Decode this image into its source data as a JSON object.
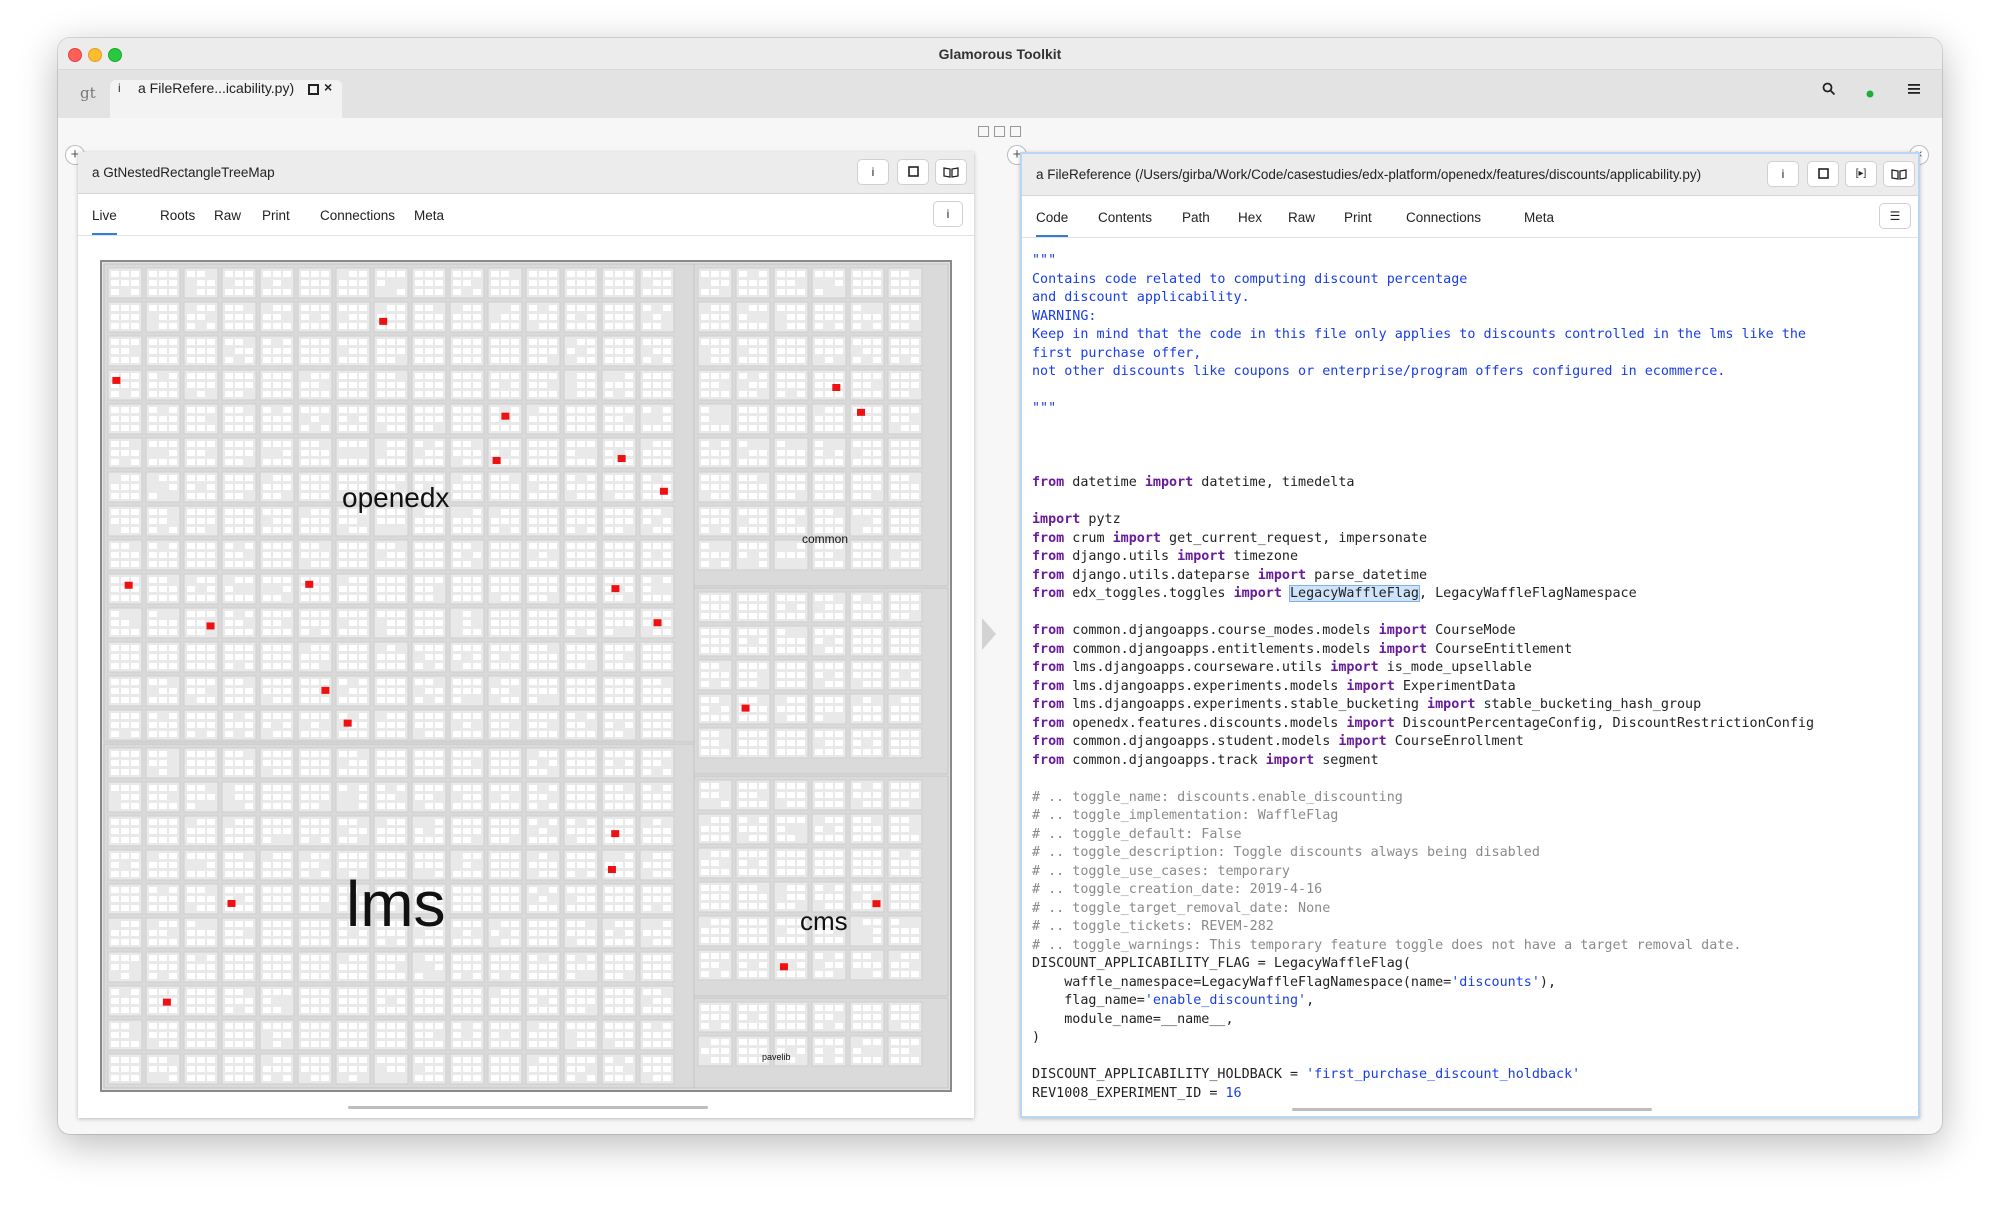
{
  "window": {
    "title": "Glamorous Toolkit",
    "logo": "gt",
    "tab": {
      "info_glyph": "i",
      "label": "a FileRefere...icability.py)",
      "close_glyph": "×"
    },
    "tools": {
      "search_glyph": "⌕",
      "status_glyph": "●",
      "menu_glyph": "≡"
    }
  },
  "left_pane": {
    "title": "a GtNestedRectangleTreeMap",
    "buttons": {
      "inspect": "i",
      "maximize": "□",
      "book": "📖"
    },
    "tabs": [
      "Live",
      "Roots",
      "Raw",
      "Print",
      "Connections",
      "Meta"
    ],
    "active_tab": "Live",
    "tab_action": "i",
    "add_glyph": "+",
    "treemap": {
      "labels": {
        "openedx": "openedx",
        "common": "common",
        "lms": "lms",
        "cms": "cms",
        "pavelib": "pavelib"
      },
      "highlight_color": "#ee1111"
    }
  },
  "right_pane": {
    "title": "a FileReference (/Users/girba/Work/Code/casestudies/edx-platform/openedx/features/discounts/applicability.py)",
    "buttons": {
      "inspect": "i",
      "maximize": "□",
      "play": "[▸]",
      "book": "📖"
    },
    "tabs": [
      "Code",
      "Contents",
      "Path",
      "Hex",
      "Raw",
      "Print",
      "Connections",
      "Meta"
    ],
    "active_tab": "Code",
    "tab_action": "☰",
    "add_glyph": "+",
    "close_glyph": "×",
    "code": {
      "doc_open": "\"\"\"",
      "doc_lines": [
        "Contains code related to computing discount percentage",
        "and discount applicability.",
        "",
        "WARNING:",
        "Keep in mind that the code in this file only applies to discounts controlled in the lms like the",
        "first purchase offer,",
        "not other discounts like coupons or enterprise/program offers configured in ecommerce.",
        "",
        "\"\"\""
      ],
      "imports": [
        [
          "from",
          " datetime ",
          "import",
          " datetime, timedelta"
        ],
        [
          "import",
          " pytz",
          "",
          ""
        ],
        [
          "from",
          " crum ",
          "import",
          " get_current_request, impersonate"
        ],
        [
          "from",
          " django.utils ",
          "import",
          " timezone"
        ],
        [
          "from",
          " django.utils.dateparse ",
          "import",
          " parse_datetime"
        ],
        [
          "from",
          " common.djangoapps.course_modes.models ",
          "import",
          " CourseMode"
        ],
        [
          "from",
          " common.djangoapps.entitlements.models ",
          "import",
          " CourseEntitlement"
        ],
        [
          "from",
          " lms.djangoapps.courseware.utils ",
          "import",
          " is_mode_upsellable"
        ],
        [
          "from",
          " lms.djangoapps.experiments.models ",
          "import",
          " ExperimentData"
        ],
        [
          "from",
          " lms.djangoapps.experiments.stable_bucketing ",
          "import",
          " stable_bucketing_hash_group"
        ],
        [
          "from",
          " openedx.features.discounts.models ",
          "import",
          " DiscountPercentageConfig, DiscountRestrictionConfig"
        ],
        [
          "from",
          " common.djangoapps.student.models ",
          "import",
          " CourseEnrollment"
        ],
        [
          "from",
          " common.djangoapps.track ",
          "import",
          " segment"
        ]
      ],
      "toggles_import": {
        "from": "from",
        "module": " edx_toggles.toggles ",
        "import": "import",
        "space": " ",
        "selected": "LegacyWaffleFlag",
        "rest": ", LegacyWaffleFlagNamespace"
      },
      "comments": [
        "# .. toggle_name: discounts.enable_discounting",
        "# .. toggle_implementation: WaffleFlag",
        "# .. toggle_default: False",
        "# .. toggle_description: Toggle discounts always being disabled",
        "# .. toggle_use_cases: temporary",
        "# .. toggle_creation_date: 2019-4-16",
        "# .. toggle_target_removal_date: None",
        "# .. toggle_tickets: REVEM-282",
        "# .. toggle_warnings: This temporary feature toggle does not have a target removal date."
      ],
      "flag_def": {
        "line1": "DISCOUNT_APPLICABILITY_FLAG = LegacyWaffleFlag(",
        "line2_a": "    waffle_namespace=LegacyWaffleFlagNamespace(name=",
        "line2_str": "'discounts'",
        "line2_b": "),",
        "line3_a": "    flag_name=",
        "line3_str": "'enable_discounting'",
        "line3_b": ",",
        "line4": "    module_name=__name__,",
        "line5": ")"
      },
      "holdback": {
        "a": "DISCOUNT_APPLICABILITY_HOLDBACK = ",
        "str": "'first_purchase_discount_holdback'"
      },
      "rev": {
        "a": "REV1008_EXPERIMENT_ID = ",
        "num": "16"
      }
    }
  }
}
